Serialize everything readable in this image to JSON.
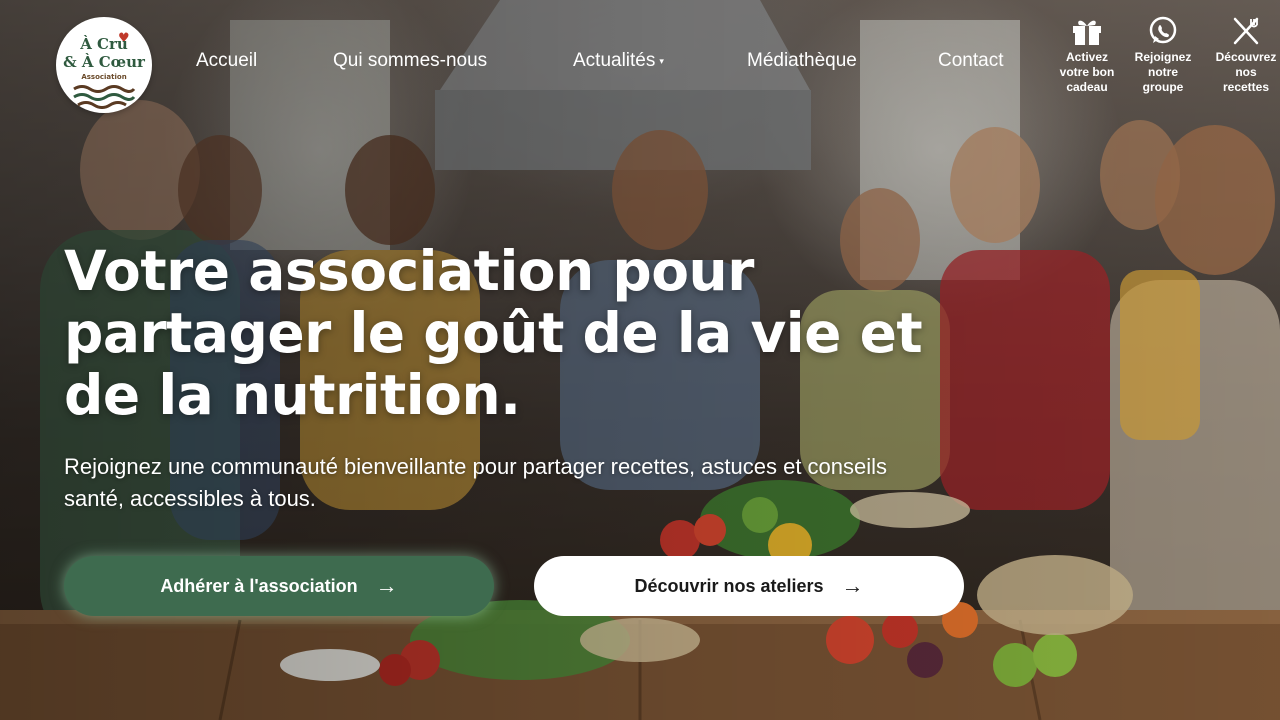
{
  "logo": {
    "line1": "À Cru",
    "line2": "& À Cœur",
    "sub": "Association"
  },
  "nav": {
    "items": [
      {
        "label": "Accueil"
      },
      {
        "label": "Qui sommes-nous"
      },
      {
        "label": "Actualités",
        "caret": "▾"
      },
      {
        "label": "Médiathèque"
      },
      {
        "label": "Contact"
      }
    ]
  },
  "quick_actions": [
    {
      "label": "Activez votre bon cadeau",
      "icon": "gift-icon"
    },
    {
      "label": "Rejoignez notre groupe",
      "icon": "whatsapp-icon"
    },
    {
      "label": "Découvrez nos recettes",
      "icon": "utensils-icon"
    }
  ],
  "hero": {
    "title": "Votre association pour partager le goût de la vie et de la nutrition.",
    "subtitle": "Rejoignez une communauté bienveillante pour partager recettes, astuces et conseils santé, accessibles à tous.",
    "primary_button": "Adhérer à l'association",
    "secondary_button": "Découvrir nos ateliers",
    "arrow": "→"
  },
  "colors": {
    "brand_green": "#3e6b4f",
    "logo_green": "#2f5a3f",
    "heart_red": "#c0392b"
  }
}
